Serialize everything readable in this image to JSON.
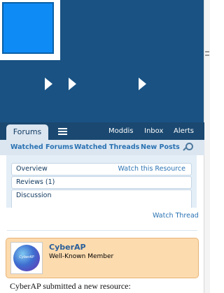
{
  "nav": {
    "home_tab": "Forums",
    "links": [
      "Moddis",
      "Inbox",
      "Alerts"
    ]
  },
  "subnav": {
    "links": [
      "Watched Forums",
      "Watched Threads",
      "New Posts"
    ]
  },
  "resource_tabs": {
    "items": [
      "Overview",
      "Reviews (1)",
      "Discussion"
    ],
    "watch_resource": "Watch this Resource"
  },
  "thread": {
    "watch_thread": "Watch Thread"
  },
  "post": {
    "username": "CyberAP",
    "user_title": "Well-Known Member",
    "avatar_text": "CyberAP",
    "message": "CyberAP submitted a new resource:"
  },
  "colors": {
    "header_bg": "#195283",
    "logo": "#0f8bf5",
    "nav_bg": "#1a4870",
    "link": "#2a72b3",
    "post_bg": "#fcdbae"
  }
}
